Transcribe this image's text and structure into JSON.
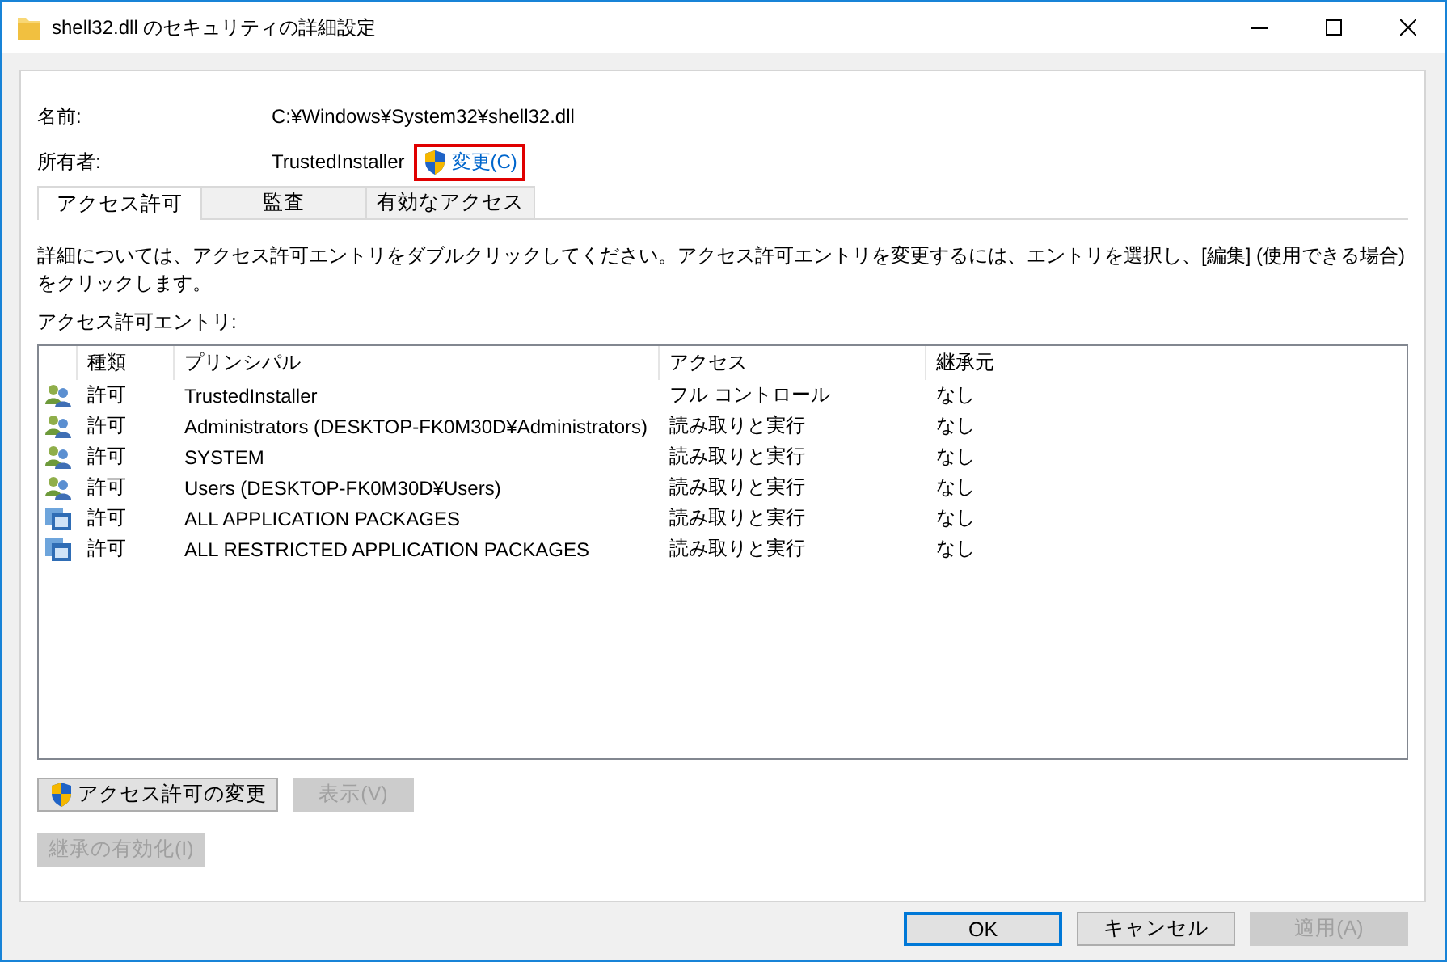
{
  "window": {
    "title": "shell32.dll のセキュリティの詳細設定"
  },
  "fields": [
    {
      "label": "名前:",
      "value": "C:¥Windows¥System32¥shell32.dll"
    },
    {
      "label": "所有者:",
      "value": "TrustedInstaller",
      "link": {
        "label": "変更(C)",
        "highlighted": true
      }
    }
  ],
  "tabs": [
    {
      "label": "アクセス許可",
      "selected": true
    },
    {
      "label": "監査",
      "selected": false
    },
    {
      "label": "有効なアクセス",
      "selected": false
    }
  ],
  "description": "詳細については、アクセス許可エントリをダブルクリックしてください。アクセス許可エントリを変更するには、エントリを選択し、[編集] (使用できる場合) をクリックします。",
  "list_label": "アクセス許可エントリ:",
  "table": {
    "columns": [
      "種類",
      "プリンシパル",
      "アクセス",
      "継承元"
    ],
    "rows": [
      {
        "kind": "user",
        "type": "許可",
        "principal": "TrustedInstaller",
        "access": "フル コントロール",
        "inherited_from": "なし"
      },
      {
        "kind": "user",
        "type": "許可",
        "principal": "Administrators (DESKTOP-FK0M30D¥Administrators)",
        "access": "読み取りと実行",
        "inherited_from": "なし"
      },
      {
        "kind": "user",
        "type": "許可",
        "principal": "SYSTEM",
        "access": "読み取りと実行",
        "inherited_from": "なし"
      },
      {
        "kind": "user",
        "type": "許可",
        "principal": "Users (DESKTOP-FK0M30D¥Users)",
        "access": "読み取りと実行",
        "inherited_from": "なし"
      },
      {
        "kind": "package",
        "type": "許可",
        "principal": "ALL APPLICATION PACKAGES",
        "access": "読み取りと実行",
        "inherited_from": "なし"
      },
      {
        "kind": "package",
        "type": "許可",
        "principal": "ALL RESTRICTED APPLICATION PACKAGES",
        "access": "読み取りと実行",
        "inherited_from": "なし"
      }
    ]
  },
  "actions": [
    [
      {
        "label": "アクセス許可の変更",
        "shield": true,
        "disabled": false
      },
      {
        "label": "表示(V)",
        "shield": false,
        "disabled": true
      }
    ],
    [
      {
        "label": "継承の有効化(I)",
        "shield": false,
        "disabled": true
      }
    ]
  ],
  "footer_buttons": [
    {
      "label": "OK",
      "default": true,
      "disabled": false
    },
    {
      "label": "キャンセル",
      "default": false,
      "disabled": false
    },
    {
      "label": "適用(A)",
      "default": false,
      "disabled": true
    }
  ]
}
